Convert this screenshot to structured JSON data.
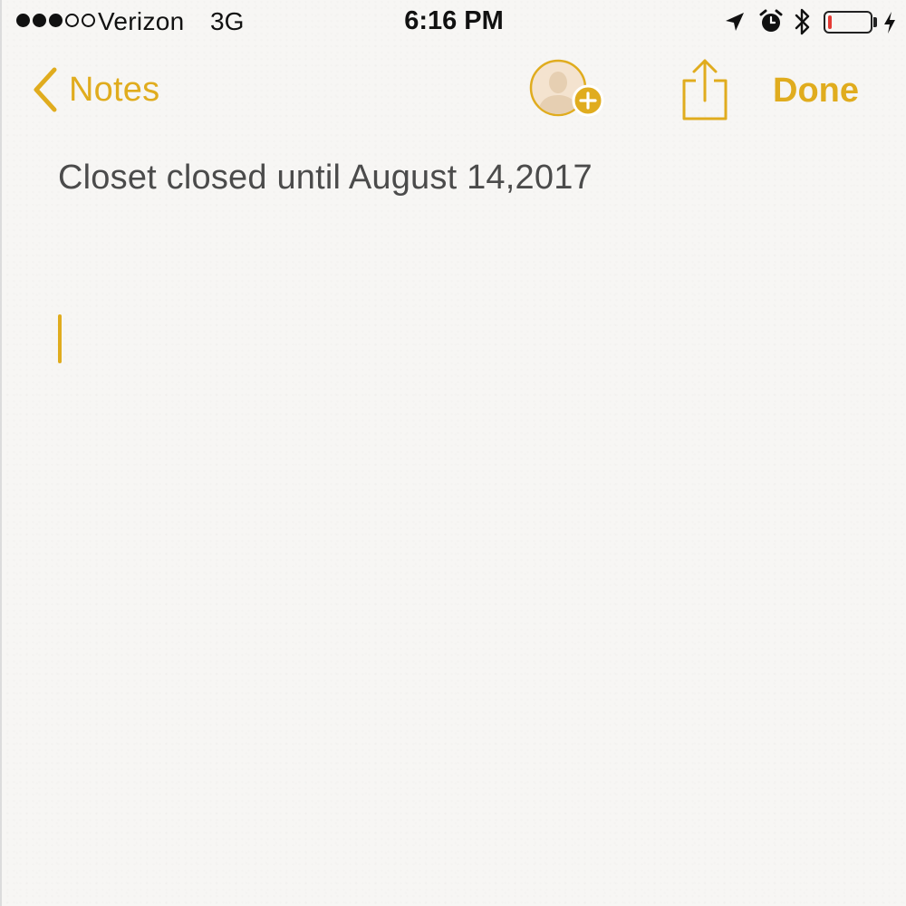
{
  "status_bar": {
    "signal_dots": [
      true,
      true,
      true,
      false,
      false
    ],
    "carrier": "Verizon",
    "network": "3G",
    "time": "6:16 PM",
    "icons": [
      "location-arrow-icon",
      "alarm-clock-icon",
      "bluetooth-icon",
      "battery-icon",
      "charging-bolt-icon"
    ],
    "battery_level_fraction": 0.1,
    "battery_color": "#e53b35"
  },
  "nav_bar": {
    "back_label": "Notes",
    "done_label": "Done",
    "accent_color": "#e0ac1e",
    "icons": [
      "chevron-left-icon",
      "add-people-icon",
      "share-icon"
    ]
  },
  "note": {
    "lines": [
      "Closet closed until August 14,2017"
    ]
  }
}
